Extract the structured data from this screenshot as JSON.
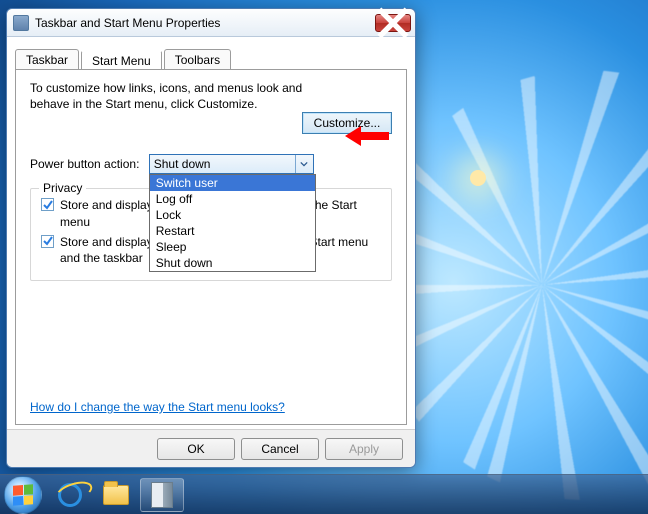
{
  "window": {
    "title": "Taskbar and Start Menu Properties"
  },
  "tabs": {
    "items": [
      "Taskbar",
      "Start Menu",
      "Toolbars"
    ],
    "active": 1
  },
  "panel": {
    "intro": "To customize how links, icons, and menus look and behave in the Start menu, click Customize.",
    "customize_label": "Customize...",
    "power_label": "Power button action:",
    "power_value": "Shut down",
    "power_options": [
      "Switch user",
      "Log off",
      "Lock",
      "Restart",
      "Sleep",
      "Shut down"
    ],
    "power_highlight": 0,
    "privacy_legend": "Privacy",
    "privacy1": "Store and display recently opened programs in the Start menu",
    "privacy1_checked": true,
    "privacy2": "Store and display recently opened items in the Start menu and the taskbar",
    "privacy2_checked": true,
    "help_link": "How do I change the way the Start menu looks?"
  },
  "buttons": {
    "ok": "OK",
    "cancel": "Cancel",
    "apply": "Apply"
  },
  "taskbar": {
    "items": [
      "start",
      "internet-explorer",
      "file-explorer",
      "properties-dialog"
    ]
  }
}
